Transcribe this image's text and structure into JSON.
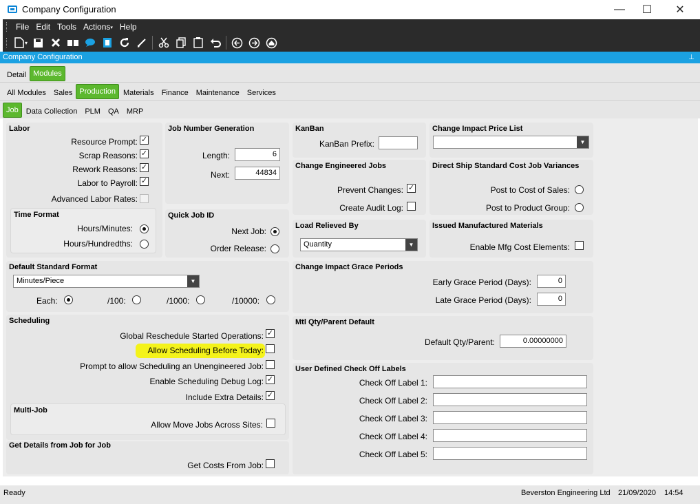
{
  "window": {
    "title": "Company Configuration",
    "minimize": "—",
    "maximize": "☐",
    "close": "✕"
  },
  "menu": [
    "File",
    "Edit",
    "Tools",
    "Actions",
    "Help"
  ],
  "toolbar_icons": [
    "new-icon",
    "save-icon",
    "delete-icon",
    "open-book-icon",
    "chat-icon",
    "attachment-icon",
    "refresh-icon",
    "clear-icon",
    "cut-icon",
    "copy-icon",
    "paste-icon",
    "undo-icon",
    "previous-icon",
    "next-icon",
    "home-icon"
  ],
  "form_header": {
    "title": "Company Configuration",
    "pin": "📌"
  },
  "tabs_level1": [
    {
      "label": "Detail",
      "selected": false
    },
    {
      "label": "Modules",
      "selected": true
    }
  ],
  "tabs_level2": [
    {
      "label": "All Modules",
      "selected": false
    },
    {
      "label": "Sales",
      "selected": false
    },
    {
      "label": "Production",
      "selected": true
    },
    {
      "label": "Materials",
      "selected": false
    },
    {
      "label": "Finance",
      "selected": false
    },
    {
      "label": "Maintenance",
      "selected": false
    },
    {
      "label": "Services",
      "selected": false
    }
  ],
  "tabs_level3": [
    {
      "label": "Job",
      "selected": true
    },
    {
      "label": "Data Collection",
      "selected": false
    },
    {
      "label": "PLM",
      "selected": false
    },
    {
      "label": "QA",
      "selected": false
    },
    {
      "label": "MRP",
      "selected": false
    }
  ],
  "labor": {
    "title": "Labor",
    "resource_prompt": "Resource Prompt:",
    "resource_prompt_checked": true,
    "scrap_reasons": "Scrap Reasons:",
    "scrap_reasons_checked": true,
    "rework_reasons": "Rework Reasons:",
    "rework_reasons_checked": true,
    "labor_to_payroll": "Labor to Payroll:",
    "labor_to_payroll_checked": true,
    "advanced_labor_rates": "Advanced Labor Rates:",
    "advanced_labor_rates_checked": false
  },
  "time_format": {
    "title": "Time Format",
    "hours_minutes": "Hours/Minutes:",
    "hours_hundredths": "Hours/Hundredths:",
    "selected": "hours_minutes"
  },
  "job_number": {
    "title": "Job Number Generation",
    "length_label": "Length:",
    "length_value": "6",
    "next_label": "Next:",
    "next_value": "44834"
  },
  "quick_job": {
    "title": "Quick Job ID",
    "next_job": "Next Job:",
    "order_release": "Order Release:",
    "selected": "next_job"
  },
  "default_std_format": {
    "title": "Default Standard Format",
    "value": "Minutes/Piece",
    "each": "Each:",
    "per100": "/100:",
    "per1000": "/1000:",
    "per10000": "/10000:",
    "selected": "each"
  },
  "scheduling": {
    "title": "Scheduling",
    "global_reschedule": "Global Reschedule Started Operations:",
    "global_reschedule_checked": true,
    "allow_before_today": "Allow Scheduling Before Today:",
    "allow_before_today_checked": false,
    "prompt_unengineered": "Prompt to allow Scheduling an Unengineered Job:",
    "prompt_unengineered_checked": false,
    "debug_log": "Enable Scheduling Debug Log:",
    "debug_log_checked": true,
    "extra_details": "Include Extra Details:",
    "extra_details_checked": true,
    "highlight_color": "#f4f31a"
  },
  "multi_job": {
    "title": "Multi-Job",
    "allow_move": "Allow Move Jobs Across Sites:",
    "allow_move_checked": false
  },
  "get_details": {
    "title": "Get Details from Job for Job",
    "get_costs": "Get Costs From Job:",
    "get_costs_checked": false
  },
  "kanban": {
    "title": "KanBan",
    "prefix_label": "KanBan Prefix:",
    "prefix_value": ""
  },
  "change_impact_price": {
    "title": "Change Impact Price List",
    "value": ""
  },
  "change_engineered": {
    "title": "Change Engineered Jobs",
    "prevent_changes": "Prevent Changes:",
    "prevent_changes_checked": true,
    "create_audit_log": "Create Audit Log:",
    "create_audit_log_checked": false
  },
  "direct_ship": {
    "title": "Direct Ship Standard Cost Job Variances",
    "post_cost_sales": "Post to Cost of Sales:",
    "post_product_group": "Post to Product Group:",
    "selected": ""
  },
  "load_relieved": {
    "title": "Load Relieved By",
    "value": "Quantity"
  },
  "issued_mfg": {
    "title": "Issued Manufactured Materials",
    "enable_cost_elements": "Enable Mfg Cost Elements:",
    "enable_cost_elements_checked": false
  },
  "grace_periods": {
    "title": "Change Impact Grace Periods",
    "early_label": "Early Grace Period (Days):",
    "early_value": "0",
    "late_label": "Late Grace Period (Days):",
    "late_value": "0"
  },
  "mtl_qty": {
    "title": "Mtl Qty/Parent Default",
    "label": "Default Qty/Parent:",
    "value": "0.00000000"
  },
  "check_off": {
    "title": "User Defined Check Off Labels",
    "labels": [
      "Check Off Label 1:",
      "Check Off Label 2:",
      "Check Off Label 3:",
      "Check Off Label 4:",
      "Check Off Label 5:"
    ],
    "values": [
      "",
      "",
      "",
      "",
      ""
    ]
  },
  "status": {
    "left": "Ready",
    "company": "Beverston Engineering Ltd",
    "date": "21/09/2020",
    "time": "14:54"
  }
}
